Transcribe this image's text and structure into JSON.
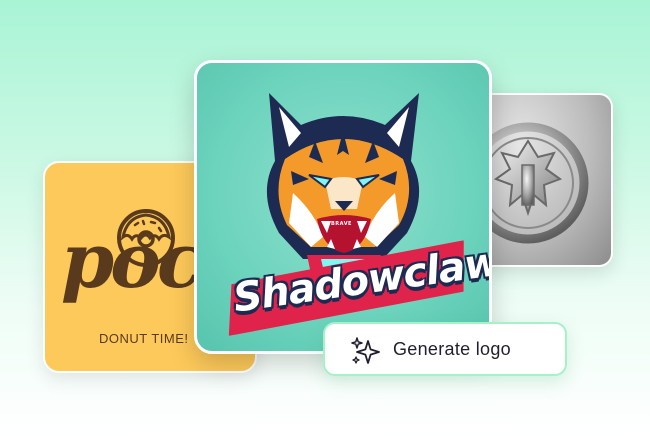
{
  "cards": {
    "donut": {
      "brand_word": "pocu",
      "tagline": "DONUT TIME!"
    },
    "tiger": {
      "wordmark": "Shadowclaw",
      "badge_text": "BRAVE"
    },
    "silver": {}
  },
  "actions": {
    "generate_label": "Generate logo"
  },
  "icons": {
    "generate": "sparkles-icon",
    "donut": "donut-icon"
  },
  "colors": {
    "background_top": "#a9f4d6",
    "donut_card": "#fdc95a",
    "donut_text": "#5a3a1c",
    "tiger_card": "#6cd3bd",
    "button_border": "#a6f1c8"
  }
}
